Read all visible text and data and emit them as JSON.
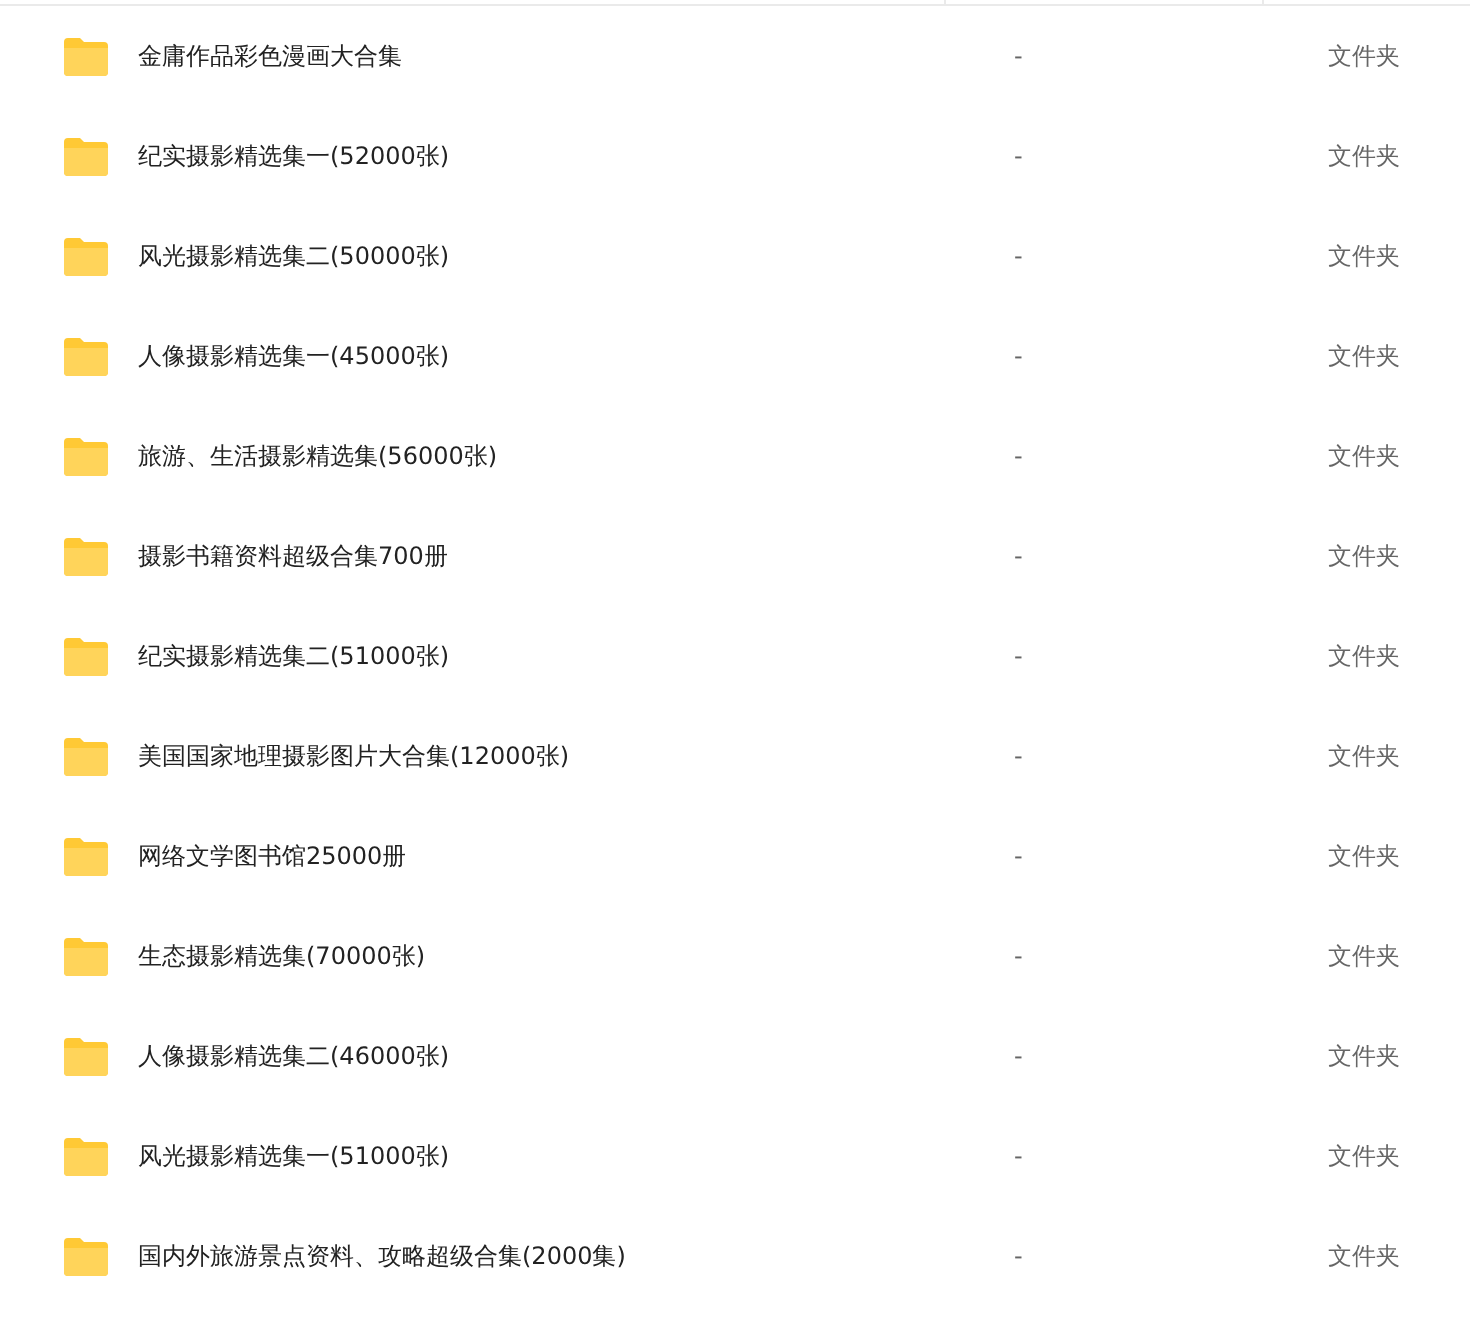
{
  "rows": [
    {
      "name": "金庸作品彩色漫画大合集",
      "size": "-",
      "type": "文件夹"
    },
    {
      "name": "纪实摄影精选集一(52000张)",
      "size": "-",
      "type": "文件夹"
    },
    {
      "name": "风光摄影精选集二(50000张)",
      "size": "-",
      "type": "文件夹"
    },
    {
      "name": "人像摄影精选集一(45000张)",
      "size": "-",
      "type": "文件夹"
    },
    {
      "name": "旅游、生活摄影精选集(56000张)",
      "size": "-",
      "type": "文件夹"
    },
    {
      "name": "摄影书籍资料超级合集700册",
      "size": "-",
      "type": "文件夹"
    },
    {
      "name": "纪实摄影精选集二(51000张)",
      "size": "-",
      "type": "文件夹"
    },
    {
      "name": "美国国家地理摄影图片大合集(12000张)",
      "size": "-",
      "type": "文件夹"
    },
    {
      "name": "网络文学图书馆25000册",
      "size": "-",
      "type": "文件夹"
    },
    {
      "name": "生态摄影精选集(70000张)",
      "size": "-",
      "type": "文件夹"
    },
    {
      "name": "人像摄影精选集二(46000张)",
      "size": "-",
      "type": "文件夹"
    },
    {
      "name": "风光摄影精选集一(51000张)",
      "size": "-",
      "type": "文件夹"
    },
    {
      "name": "国内外旅游景点资料、攻略超级合集(2000集)",
      "size": "-",
      "type": "文件夹"
    }
  ]
}
